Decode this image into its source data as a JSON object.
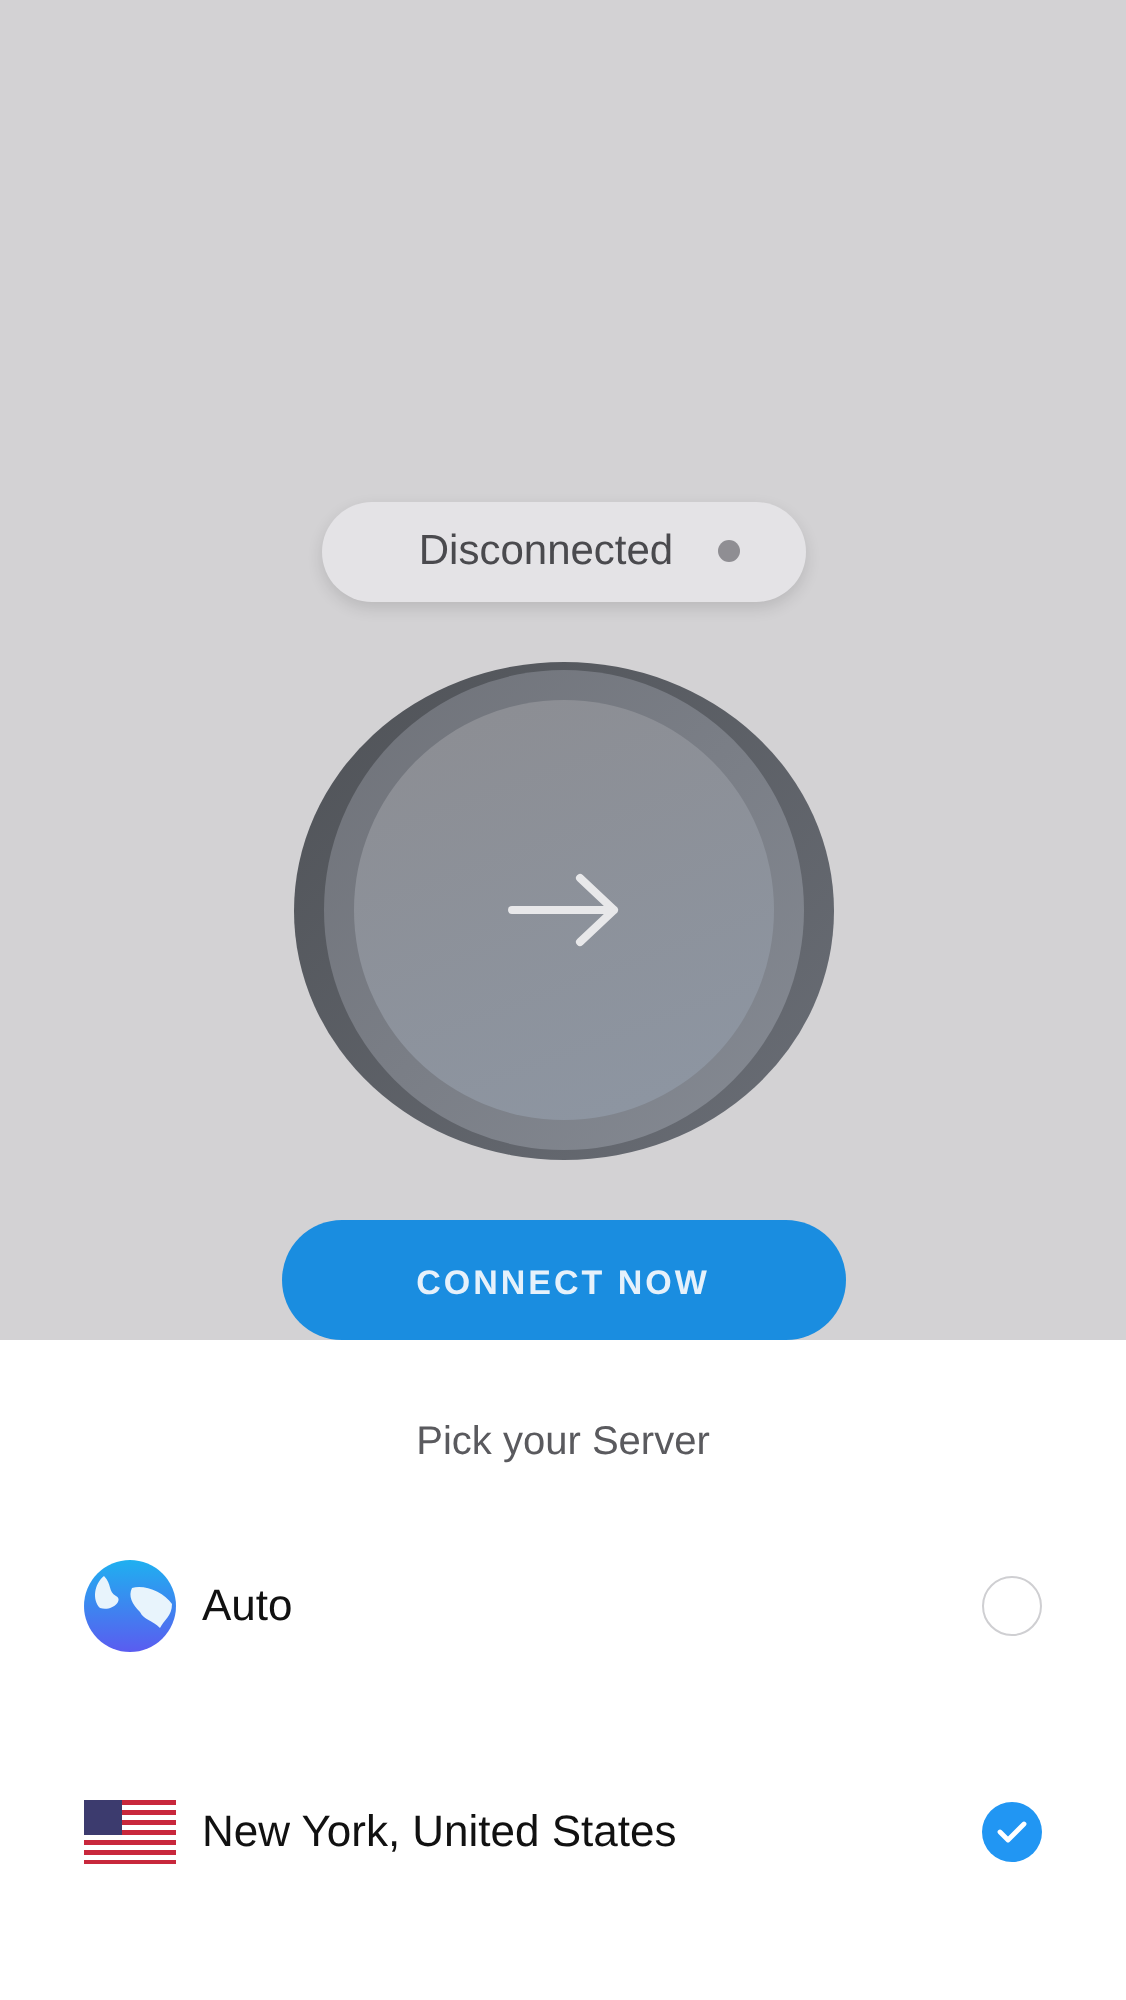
{
  "status": {
    "label": "Disconnected",
    "connected": false
  },
  "connect_button": {
    "label": "CONNECT NOW"
  },
  "server_sheet": {
    "title": "Pick your Server",
    "servers": [
      {
        "kind": "globe",
        "name": "Auto",
        "selected": false
      },
      {
        "kind": "flag",
        "name": "New York, United States",
        "selected": true
      }
    ]
  }
}
